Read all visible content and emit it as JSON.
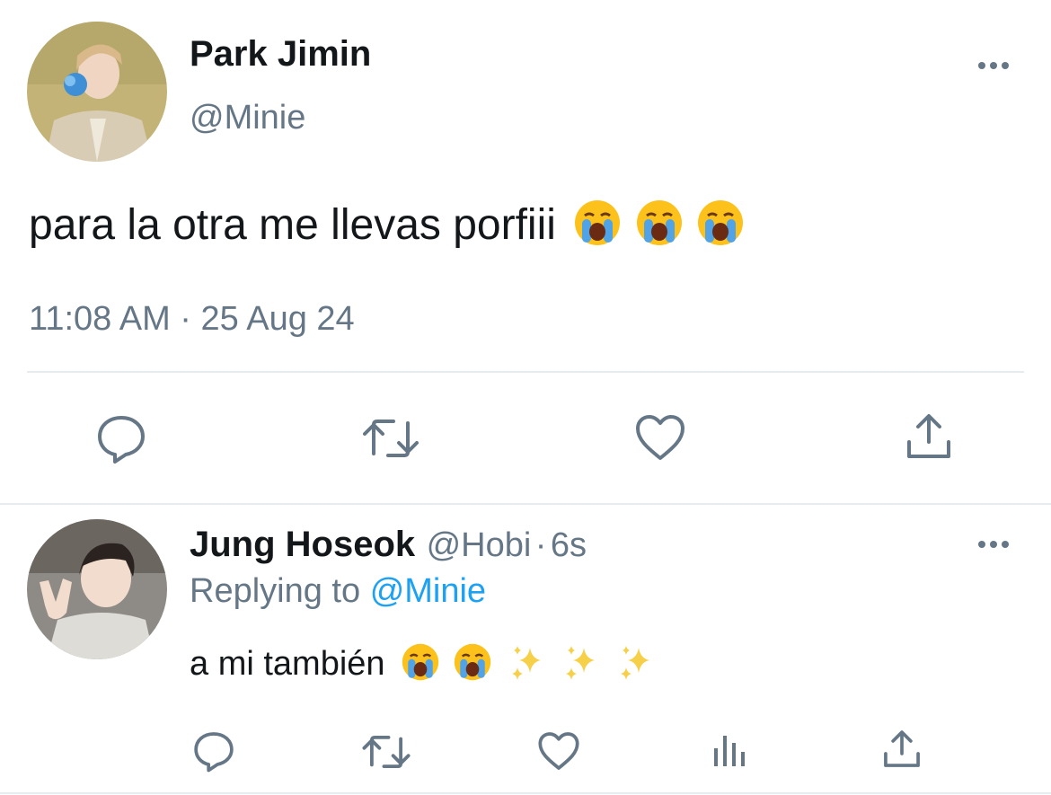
{
  "tweet": {
    "name": "Park Jimin",
    "handle": "@Minie",
    "text": "para la otra me llevas porfiii",
    "emojis": [
      "crying-face",
      "crying-face",
      "crying-face"
    ],
    "meta": {
      "time": "11:08 AM",
      "separator": "·",
      "date": "25 Aug 24"
    },
    "actions": [
      "reply-icon",
      "retweet-icon",
      "like-icon",
      "share-icon"
    ]
  },
  "reply": {
    "name": "Jung Hoseok",
    "handle": "@Hobi",
    "separator": "·",
    "age": "6s",
    "replying_to_label": "Replying to",
    "replying_to_handle": "@Minie",
    "text": "a mi también",
    "emojis": [
      "crying-face",
      "crying-face",
      "sparkles",
      "sparkles",
      "sparkles"
    ],
    "actions": [
      "reply-icon",
      "retweet-icon",
      "like-icon",
      "analytics-icon",
      "share-icon"
    ]
  },
  "colors": {
    "text": "#14171a",
    "muted": "#657786",
    "link": "#1da1f2",
    "divider": "#e6ecf0"
  }
}
